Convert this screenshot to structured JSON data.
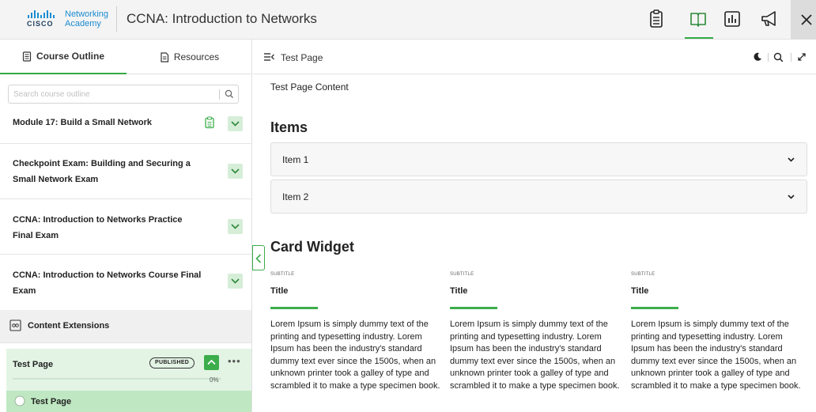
{
  "header": {
    "logo_top": "Networking",
    "logo_brand": "CISCO",
    "logo_bottom": "Academy",
    "course_title": "CCNA: Introduction to Networks",
    "icons": [
      "clipboard-icon",
      "book-icon",
      "chart-icon",
      "megaphone-icon",
      "close-icon"
    ]
  },
  "left": {
    "tabs": [
      {
        "label": "Course Outline"
      },
      {
        "label": "Resources"
      }
    ],
    "search_placeholder": "Search course outline",
    "modules": [
      {
        "title": "Module 17: Build a Small Network"
      },
      {
        "title": "Checkpoint Exam: Building and Securing a Small Network Exam"
      },
      {
        "title": "CCNA: Introduction to Networks Practice Final Exam"
      },
      {
        "title": "CCNA: Introduction to Networks Course Final Exam"
      }
    ],
    "extensions_label": "Content Extensions",
    "test_page": {
      "title": "Test Page",
      "badge": "PUBLISHED",
      "progress_label": "0%",
      "progress": 0
    },
    "sub_page": {
      "title": "Test Page"
    }
  },
  "main": {
    "page_title": "Test Page",
    "content_text": "Test Page Content",
    "items_heading": "Items",
    "items": [
      {
        "label": "Item 1"
      },
      {
        "label": "Item 2"
      }
    ],
    "card_heading": "Card Widget",
    "cards": [
      {
        "subtitle": "SUBTITLE",
        "title": "Title",
        "body": "Lorem Ipsum is simply dummy text of the printing and typesetting industry. Lorem Ipsum has been the industry's standard dummy text ever since the 1500s, when an unknown printer took a galley of type and scrambled it to make a type specimen book."
      },
      {
        "subtitle": "SUBTITLE",
        "title": "Title",
        "body": "Lorem Ipsum is simply dummy text of the printing and typesetting industry. Lorem Ipsum has been the industry's standard dummy text ever since the 1500s, when an unknown printer took a galley of type and scrambled it to make a type specimen book."
      },
      {
        "subtitle": "SUBTITLE",
        "title": "Title",
        "body": "Lorem Ipsum is simply dummy text of the printing and typesetting industry. Lorem Ipsum has been the industry's standard dummy text ever since the 1500s, when an unknown printer took a galley of type and scrambled it to make a type specimen book."
      }
    ]
  },
  "colors": {
    "accent": "#3cad4b",
    "link": "#1c8bd0",
    "published_bg": "#e3f4e4",
    "selected_bg": "#bfe8c2"
  }
}
